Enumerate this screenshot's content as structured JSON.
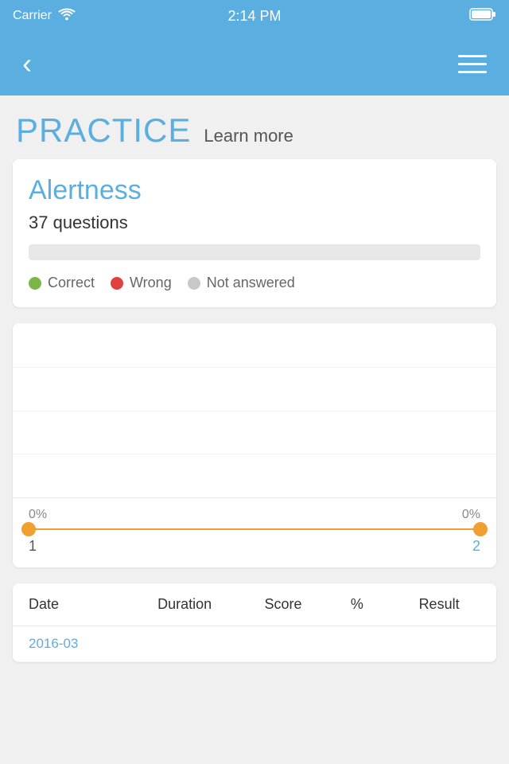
{
  "statusBar": {
    "carrier": "Carrier",
    "time": "2:14 PM"
  },
  "navBar": {
    "backLabel": "‹",
    "menuLabel": "menu"
  },
  "header": {
    "title": "PRACTICE",
    "learnMore": "Learn more"
  },
  "alertnessCard": {
    "title": "Alertness",
    "questionsCount": "37 questions",
    "progressPercent": 0,
    "legend": [
      {
        "label": "Correct",
        "color": "#7ab648"
      },
      {
        "label": "Wrong",
        "color": "#e04040"
      },
      {
        "label": "Not answered",
        "color": "#c8c8c8"
      }
    ]
  },
  "chartCard": {
    "leftPercent": "0%",
    "rightPercent": "0%",
    "leftLabel": "1",
    "rightLabel": "2"
  },
  "tableCard": {
    "headers": [
      "Date",
      "Duration",
      "Score",
      "%",
      "Result"
    ],
    "rows": [
      {
        "date": "2016-03",
        "duration": "",
        "score": "",
        "percent": "",
        "result": ""
      }
    ]
  }
}
